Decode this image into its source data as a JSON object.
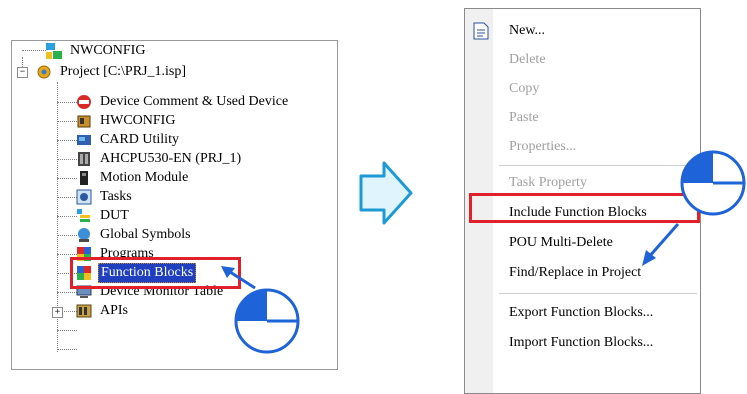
{
  "tree": {
    "root_item": "NWCONFIG",
    "project_item": "Project [C:\\PRJ_1.isp]",
    "children": [
      {
        "label": "Device Comment & Used Device",
        "icon": "device-comment-icon"
      },
      {
        "label": "HWCONFIG",
        "icon": "hwconfig-icon"
      },
      {
        "label": "CARD Utility",
        "icon": "card-icon"
      },
      {
        "label": "AHCPU530-EN  (PRJ_1)",
        "icon": "cpu-icon"
      },
      {
        "label": "Motion Module",
        "icon": "motion-module-icon"
      },
      {
        "label": "Tasks",
        "icon": "tasks-icon"
      },
      {
        "label": "DUT",
        "icon": "dut-icon"
      },
      {
        "label": "Global Symbols",
        "icon": "globe-icon"
      },
      {
        "label": "Programs",
        "icon": "programs-icon"
      },
      {
        "label": "Function Blocks",
        "icon": "function-blocks-icon",
        "selected": true
      },
      {
        "label": "Device Monitor Table",
        "icon": "monitor-icon"
      },
      {
        "label": "APIs",
        "icon": "apis-icon"
      }
    ]
  },
  "menu": {
    "items": [
      {
        "label": "New...",
        "enabled": true
      },
      {
        "label": "Delete",
        "enabled": false
      },
      {
        "label": "Copy",
        "enabled": false
      },
      {
        "label": "Paste",
        "enabled": false
      },
      {
        "label": "Properties...",
        "enabled": false
      },
      {
        "label": "Task Property",
        "enabled": false
      },
      {
        "label": "Include Function Blocks",
        "enabled": true,
        "highlighted": true
      },
      {
        "label": "POU Multi-Delete",
        "enabled": true
      },
      {
        "label": "Find/Replace in Project",
        "enabled": true
      },
      {
        "label": "Export Function Blocks...",
        "enabled": true
      },
      {
        "label": "Import Function Blocks...",
        "enabled": true
      }
    ]
  },
  "colors": {
    "highlight": "#e0202a",
    "arrow_fill": "#dff4fd",
    "arrow_stroke": "#1c9ad6",
    "pointer": "#1e63d8"
  }
}
